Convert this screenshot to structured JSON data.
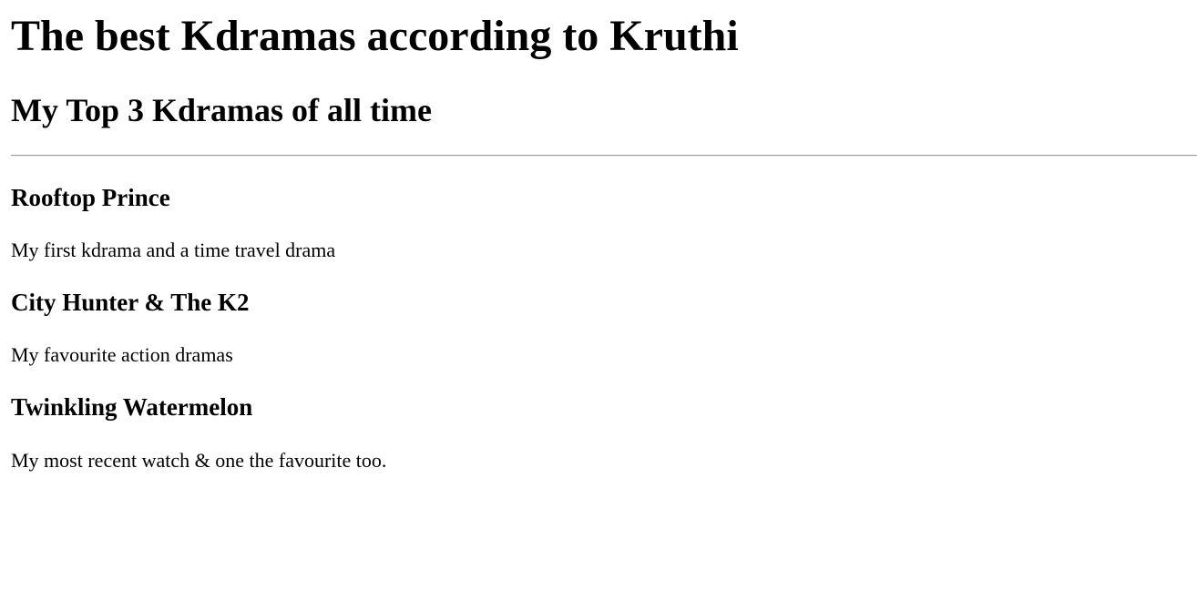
{
  "page": {
    "title": "The best Kdramas according to Kruthi",
    "subtitle": "My Top 3 Kdramas of all time"
  },
  "dramas": [
    {
      "title": "Rooftop Prince",
      "description": "My first kdrama and a time travel drama"
    },
    {
      "title": "City Hunter & The K2",
      "description": "My favourite action dramas"
    },
    {
      "title": "Twinkling Watermelon",
      "description": "My most recent watch & one the favourite too."
    }
  ]
}
